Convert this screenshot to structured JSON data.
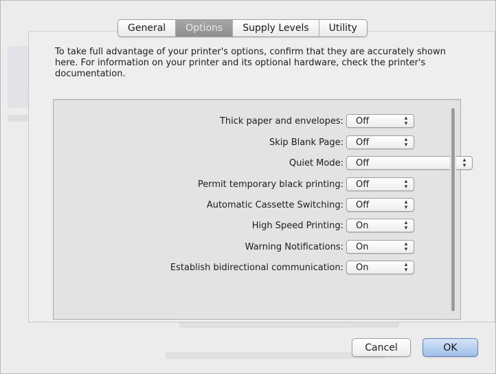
{
  "tabs": [
    {
      "label": "General",
      "selected": false
    },
    {
      "label": "Options",
      "selected": true
    },
    {
      "label": "Supply Levels",
      "selected": false
    },
    {
      "label": "Utility",
      "selected": false
    }
  ],
  "description": "To take full advantage of your printer's options, confirm that they are accurately shown here. For information on your printer and its optional hardware, check the printer's documentation.",
  "options": [
    {
      "label": "Thick paper and envelopes:",
      "value": "Off"
    },
    {
      "label": "Skip Blank Page:",
      "value": "Off"
    },
    {
      "label": "Quiet Mode:",
      "value": "Off"
    },
    {
      "label": "Permit temporary black printing:",
      "value": "Off"
    },
    {
      "label": "Automatic Cassette Switching:",
      "value": "Off"
    },
    {
      "label": "High Speed Printing:",
      "value": "On"
    },
    {
      "label": "Warning Notifications:",
      "value": "On"
    },
    {
      "label": "Establish bidirectional communication:",
      "value": "On"
    }
  ],
  "buttons": {
    "cancel": "Cancel",
    "ok": "OK"
  },
  "icons": {
    "popup": "up-down-arrows-icon"
  },
  "colors": {
    "selected_tab": "#999999",
    "default_button": "#a9c6ee"
  }
}
